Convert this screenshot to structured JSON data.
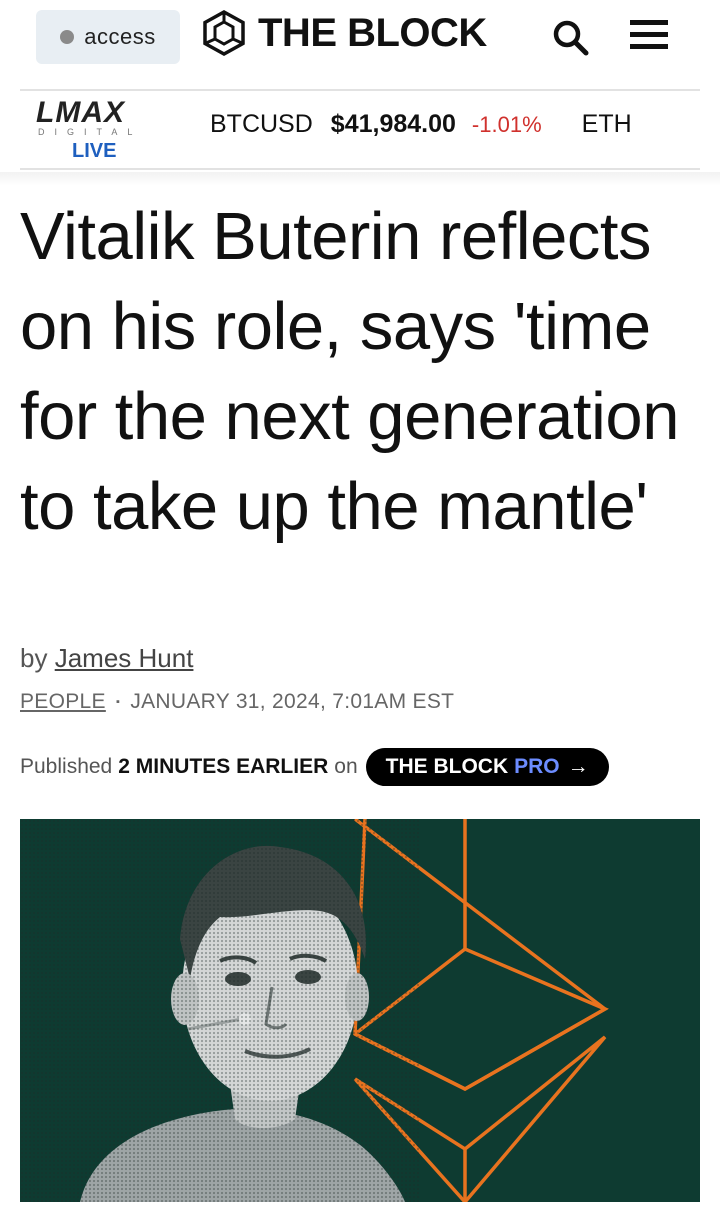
{
  "header": {
    "access_label": "access",
    "logo_text": "THE BLOCK",
    "search_icon": "search-icon",
    "menu_icon": "hamburger-menu-icon"
  },
  "ticker": {
    "brand": "LMAX",
    "brand_sub": "DIGITAL",
    "live_label": "LIVE",
    "symbol": "BTCUSD",
    "price": "$41,984.00",
    "change": "-1.01%",
    "next_symbol": "ETH",
    "change_color": "#d0312d",
    "live_color": "#1e5fbf"
  },
  "article": {
    "headline": "Vitalik Buterin reflects on his role, says 'time for the next generation to take up the mantle'",
    "by_label": "by",
    "author": "James Hunt",
    "category": "PEOPLE",
    "separator": "▪",
    "date": "JANUARY 31, 2024, 7:01AM EST",
    "published_prefix": "Published",
    "published_when": "2 MINUTES EARLIER",
    "published_on": "on",
    "pro_brand": "THE BLOCK",
    "pro_word": "PRO",
    "pro_arrow": "→"
  },
  "hero": {
    "background_color": "#0e3b31",
    "accent_color": "#e8731f",
    "image_subject": "portrait-photo"
  }
}
